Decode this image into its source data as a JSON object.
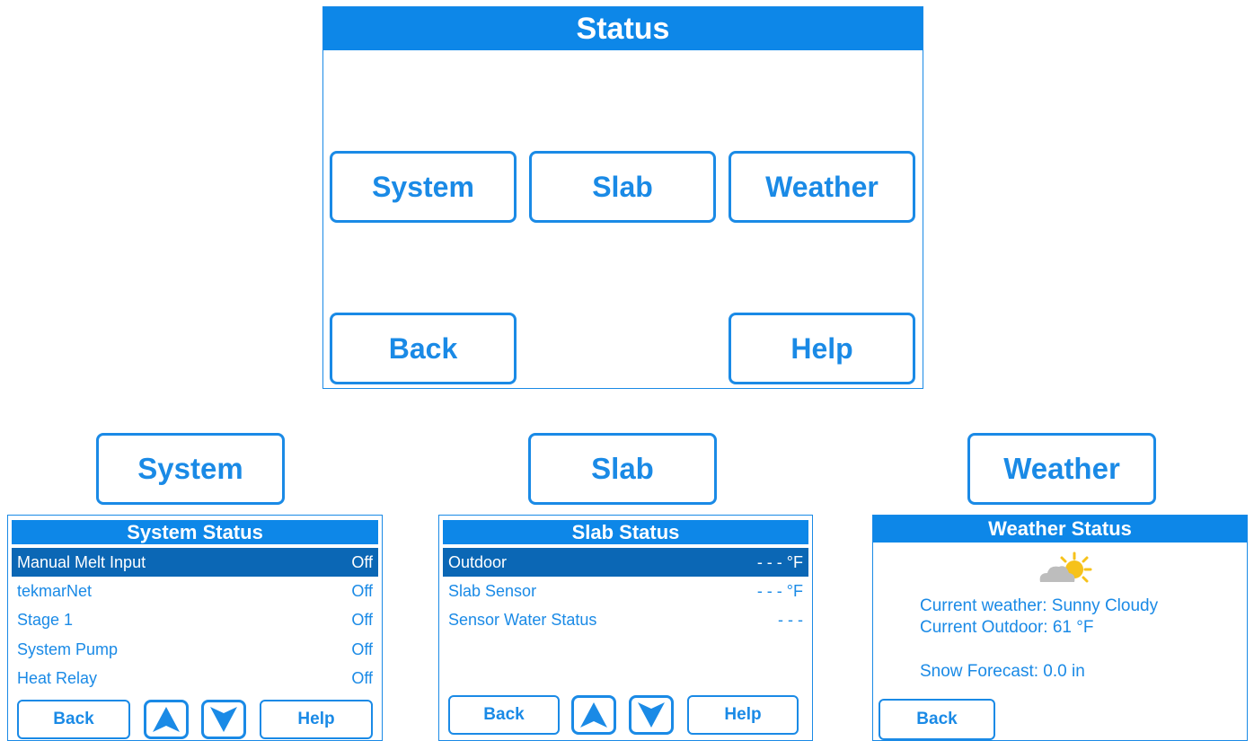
{
  "main": {
    "title": "Status",
    "buttons": {
      "system": "System",
      "slab": "Slab",
      "weather": "Weather",
      "back": "Back",
      "help": "Help"
    }
  },
  "headers": {
    "system": "System",
    "slab": "Slab",
    "weather": "Weather"
  },
  "system_status": {
    "title": "System Status",
    "rows": [
      {
        "label": "Manual Melt Input",
        "value": "Off"
      },
      {
        "label": "tekmarNet",
        "value": "Off"
      },
      {
        "label": "Stage 1",
        "value": "Off"
      },
      {
        "label": "System Pump",
        "value": "Off"
      },
      {
        "label": "Heat Relay",
        "value": "Off"
      }
    ],
    "back": "Back",
    "help": "Help"
  },
  "slab_status": {
    "title": "Slab Status",
    "rows": [
      {
        "label": "Outdoor",
        "value": "- - - °F"
      },
      {
        "label": "Slab Sensor",
        "value": "- - - °F"
      },
      {
        "label": "Sensor Water Status",
        "value": "- - -"
      }
    ],
    "back": "Back",
    "help": "Help"
  },
  "weather_status": {
    "title": "Weather Status",
    "icon": "partly-sunny-icon",
    "current_weather": "Current weather: Sunny Cloudy",
    "current_outdoor": "Current Outdoor: 61 °F",
    "snow_forecast": "Snow Forecast: 0.0 in",
    "back": "Back"
  },
  "colors": {
    "accent": "#1a8ae6",
    "title_bar": "#0d87e8",
    "selected_row": "#0b67b5"
  }
}
